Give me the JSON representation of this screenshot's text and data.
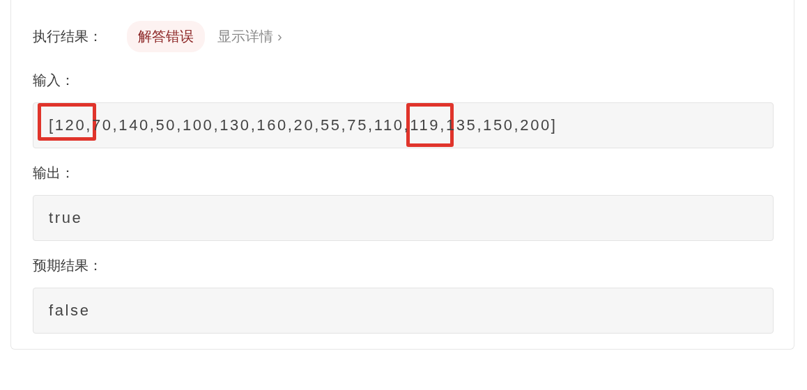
{
  "result": {
    "label": "执行结果：",
    "status": "解答错误",
    "details_link": "显示详情",
    "details_chevron": "›"
  },
  "fields": [
    {
      "label": "输入：",
      "value": "[120,70,140,50,100,130,160,20,55,75,110,119,135,150,200]",
      "annotations": [
        {
          "kind": "highlight-box"
        },
        {
          "kind": "highlight-box"
        }
      ]
    },
    {
      "label": "输出：",
      "value": "true"
    },
    {
      "label": "预期结果：",
      "value": "false"
    }
  ]
}
